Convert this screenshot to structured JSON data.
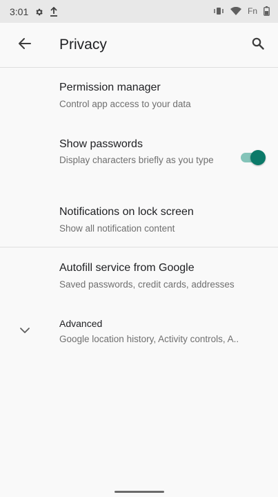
{
  "status_bar": {
    "time": "3:01",
    "carrier_label": "Fn",
    "icons": [
      "settings-gear-icon",
      "upload-icon",
      "vibrate-icon",
      "wifi-icon",
      "battery-icon"
    ]
  },
  "app_bar": {
    "title": "Privacy",
    "back_icon": "arrow-left-icon",
    "search_icon": "search-icon"
  },
  "items": [
    {
      "title": "Permission manager",
      "subtitle": "Control app access to your data"
    },
    {
      "title": "Show passwords",
      "subtitle": "Display characters briefly as you type",
      "toggle_on": true
    },
    {
      "title": "Notifications on lock screen",
      "subtitle": "Show all notification content"
    },
    {
      "title": "Autofill service from Google",
      "subtitle": "Saved passwords, credit cards, addresses"
    },
    {
      "title": "Advanced",
      "subtitle": "Google location history, Activity controls, A..",
      "icon": "chevron-down-icon"
    }
  ],
  "colors": {
    "accent": "#0b7a69",
    "accent_track": "#84c4b9",
    "background": "#f9f9f9",
    "status_bar": "#e8e8e8"
  }
}
